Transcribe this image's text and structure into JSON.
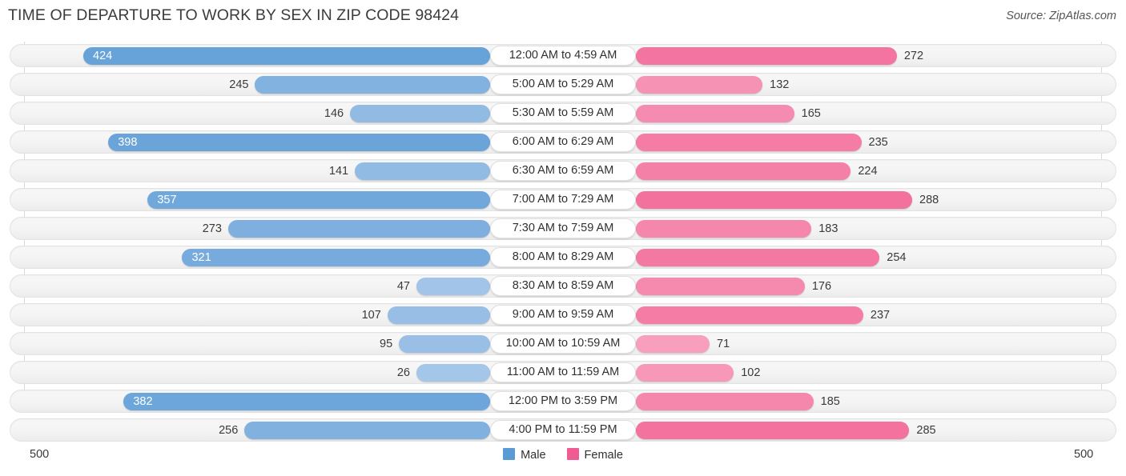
{
  "header": {
    "title": "TIME OF DEPARTURE TO WORK BY SEX IN ZIP CODE 98424",
    "source": "Source: ZipAtlas.com"
  },
  "axis": {
    "left_cap": "500",
    "right_cap": "500"
  },
  "legend": {
    "items": [
      {
        "label": "Male",
        "color": "#5b9bd5"
      },
      {
        "label": "Female",
        "color": "#ef5b92"
      }
    ]
  },
  "chart_data": {
    "type": "bar",
    "subtype": "diverging-butterfly",
    "title": "TIME OF DEPARTURE TO WORK BY SEX IN ZIP CODE 98424",
    "xlabel": "",
    "ylabel": "",
    "axis_max": 500,
    "xlim": [
      500,
      500
    ],
    "grid": true,
    "legend_position": "bottom-center",
    "categories": [
      "12:00 AM to 4:59 AM",
      "5:00 AM to 5:29 AM",
      "5:30 AM to 5:59 AM",
      "6:00 AM to 6:29 AM",
      "6:30 AM to 6:59 AM",
      "7:00 AM to 7:29 AM",
      "7:30 AM to 7:59 AM",
      "8:00 AM to 8:29 AM",
      "8:30 AM to 8:59 AM",
      "9:00 AM to 9:59 AM",
      "10:00 AM to 10:59 AM",
      "11:00 AM to 11:59 AM",
      "12:00 PM to 3:59 PM",
      "4:00 PM to 11:59 PM"
    ],
    "series": [
      {
        "name": "Male",
        "color": "#5b9bd5",
        "side": "left",
        "values": [
          424,
          245,
          146,
          398,
          141,
          357,
          273,
          321,
          47,
          107,
          95,
          26,
          382,
          256
        ]
      },
      {
        "name": "Female",
        "color": "#ef5b92",
        "side": "right",
        "values": [
          272,
          132,
          165,
          235,
          224,
          288,
          183,
          254,
          176,
          237,
          71,
          102,
          185,
          285
        ]
      }
    ]
  }
}
